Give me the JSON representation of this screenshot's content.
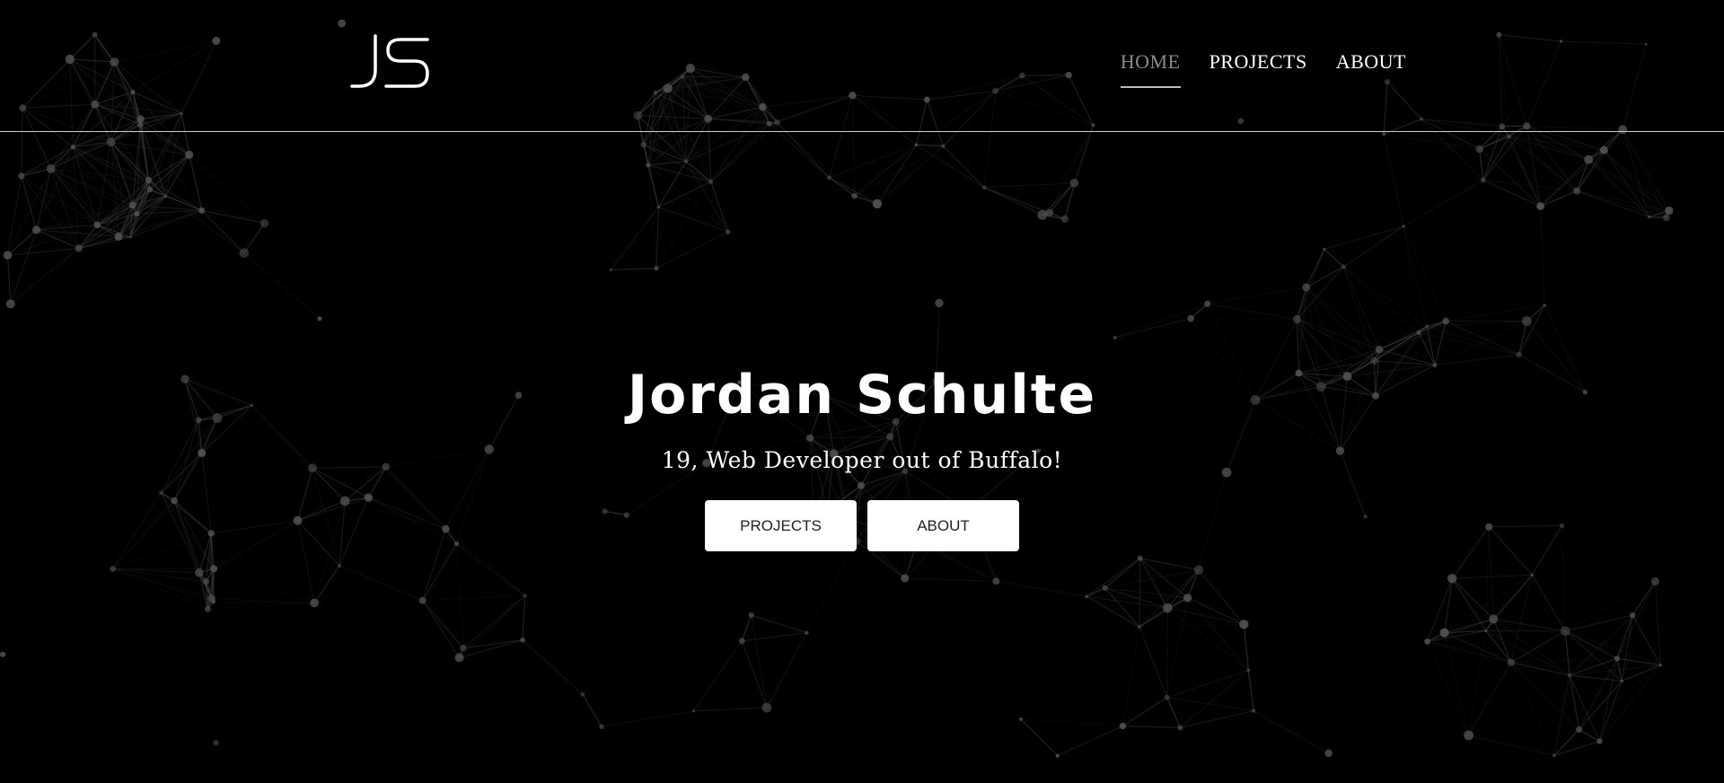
{
  "brand": {
    "logo_icon": "js-monogram-icon",
    "text_color": "#ffffff"
  },
  "nav": {
    "items": [
      {
        "label": "HOME",
        "active": true
      },
      {
        "label": "PROJECTS",
        "active": false
      },
      {
        "label": "ABOUT",
        "active": false
      }
    ]
  },
  "hero": {
    "title": "Jordan Schulte",
    "subtitle": "19, Web Developer out of Buffalo!",
    "buttons": [
      {
        "label": "PROJECTS"
      },
      {
        "label": "ABOUT"
      }
    ]
  },
  "theme": {
    "background": "#000000",
    "network_line": "#3a3a3a",
    "network_node": "#555555",
    "nav_active": "#8a8a8a"
  }
}
